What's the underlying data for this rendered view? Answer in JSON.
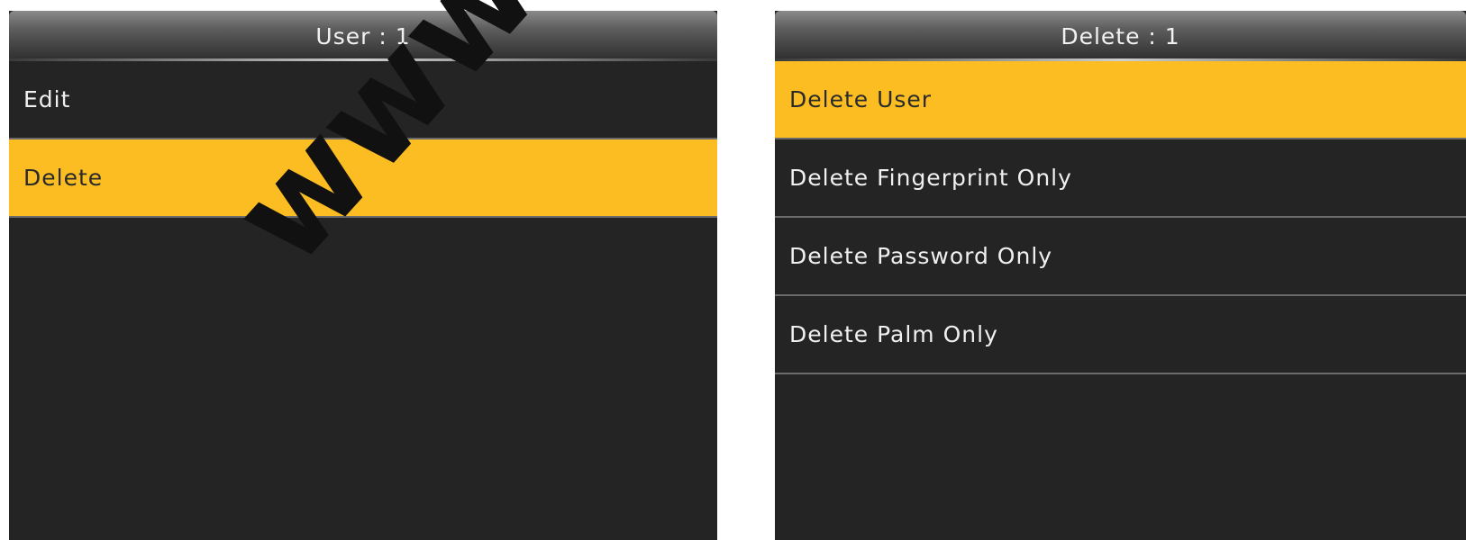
{
  "left_panel": {
    "title": "User : 1",
    "items": [
      {
        "label": "Edit",
        "selected": false
      },
      {
        "label": "Delete",
        "selected": true
      }
    ]
  },
  "right_panel": {
    "title": "Delete : 1",
    "items": [
      {
        "label": "Delete User",
        "selected": true
      },
      {
        "label": "Delete Fingerprint Only",
        "selected": false
      },
      {
        "label": "Delete Password Only",
        "selected": false
      },
      {
        "label": "Delete Palm Only",
        "selected": false
      }
    ]
  },
  "watermark": {
    "text": "www.sec.ua"
  },
  "colors": {
    "highlight": "#fbbd22",
    "background": "#242424",
    "text": "#f0f0f0",
    "selected_text": "#2a2a2a"
  }
}
